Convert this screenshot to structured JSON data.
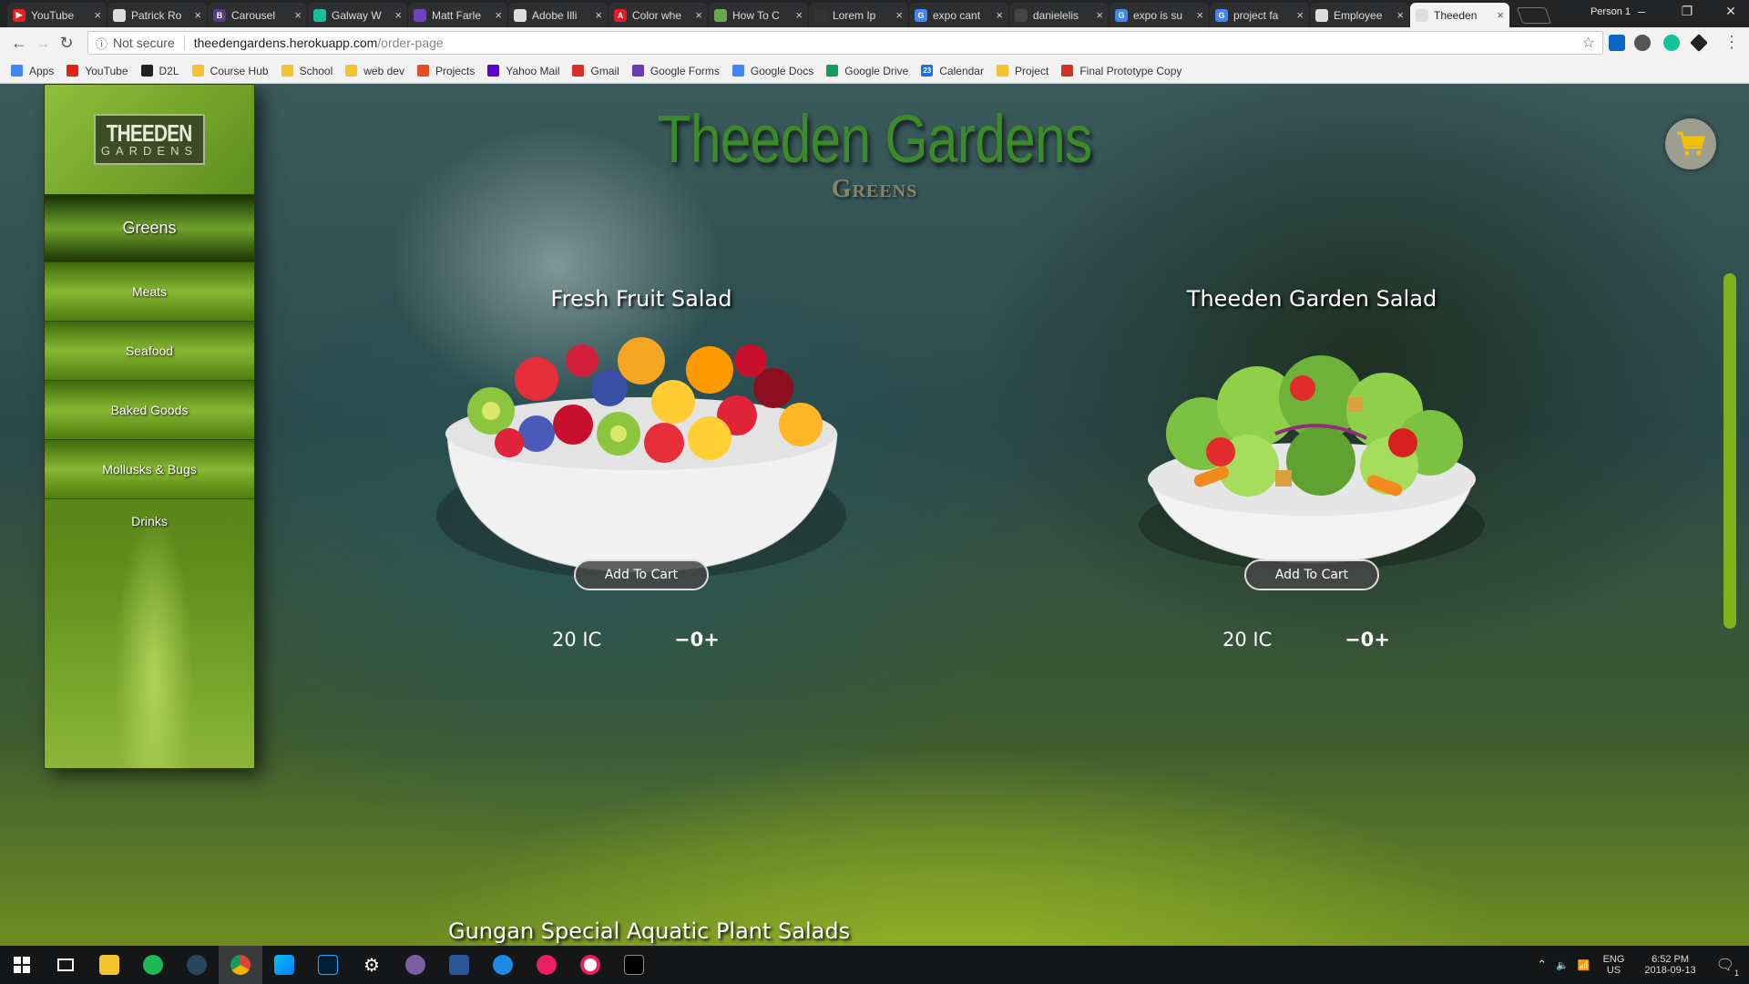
{
  "browser": {
    "tabs": [
      {
        "title": "YouTube",
        "favicon_color": "#e62117",
        "glyph": "▶"
      },
      {
        "title": "Patrick Ro",
        "favicon_color": "#dddddd",
        "glyph": ""
      },
      {
        "title": "Carousel",
        "favicon_color": "#563d7c",
        "glyph": "B"
      },
      {
        "title": "Galway W",
        "favicon_color": "#1abc9c",
        "glyph": ""
      },
      {
        "title": "Matt Farle",
        "favicon_color": "#6f42c1",
        "glyph": ""
      },
      {
        "title": "Adobe Illi",
        "favicon_color": "#dddddd",
        "glyph": ""
      },
      {
        "title": "Color whe",
        "favicon_color": "#e31b23",
        "glyph": "A"
      },
      {
        "title": "How To C",
        "favicon_color": "#6aa84f",
        "glyph": ""
      },
      {
        "title": "Lorem Ip",
        "favicon_color": "#333333",
        "glyph": ""
      },
      {
        "title": "expo cant",
        "favicon_color": "#4285f4",
        "glyph": "G"
      },
      {
        "title": "danielelis",
        "favicon_color": "#444444",
        "glyph": ""
      },
      {
        "title": "expo is su",
        "favicon_color": "#4285f4",
        "glyph": "G"
      },
      {
        "title": "project fa",
        "favicon_color": "#4285f4",
        "glyph": "G"
      },
      {
        "title": "Employee",
        "favicon_color": "#dddddd",
        "glyph": ""
      },
      {
        "title": "Theeden",
        "favicon_color": "#dddddd",
        "glyph": "",
        "active": true
      }
    ],
    "profile": "Person 1",
    "window_controls": {
      "minimize": "–",
      "restore": "❐",
      "close": "✕"
    },
    "omnibox": {
      "security": "Not secure",
      "host": "theedengardens.herokuapp.com",
      "path": "/order-page"
    },
    "bookmarks": [
      {
        "label": "Apps",
        "color": "#4285f4"
      },
      {
        "label": "YouTube",
        "color": "#e62117"
      },
      {
        "label": "D2L",
        "color": "#222222"
      },
      {
        "label": "Course Hub",
        "color": "#f4c430"
      },
      {
        "label": "School",
        "color": "#f4c430"
      },
      {
        "label": "web dev",
        "color": "#f4c430"
      },
      {
        "label": "Projects",
        "color": "#e44d26"
      },
      {
        "label": "Yahoo Mail",
        "color": "#5f01d1"
      },
      {
        "label": "Gmail",
        "color": "#d93025"
      },
      {
        "label": "Google Forms",
        "color": "#673ab7"
      },
      {
        "label": "Google Docs",
        "color": "#4285f4"
      },
      {
        "label": "Google Drive",
        "color": "#0f9d58"
      },
      {
        "label": "Calendar",
        "color": "#1a73e8",
        "glyph": "23"
      },
      {
        "label": "Project",
        "color": "#f4c430"
      },
      {
        "label": "Final Prototype Copy",
        "color": "#d93025"
      }
    ]
  },
  "site": {
    "logo": {
      "line1": "THEEDEN",
      "line2": "GARDENS"
    },
    "title": "Theeden Gardens",
    "subtitle": "Greens",
    "nav": [
      {
        "label": "Greens",
        "active": true
      },
      {
        "label": "Meats"
      },
      {
        "label": "Seafood"
      },
      {
        "label": "Baked Goods"
      },
      {
        "label": "Mollusks & Bugs"
      },
      {
        "label": "Drinks"
      }
    ],
    "products": [
      {
        "name": "Fresh Fruit Salad",
        "button": "Add To Cart",
        "price": "20 IC",
        "minus": "−",
        "qty": "0",
        "plus": "+"
      },
      {
        "name": "Theeden Garden Salad",
        "button": "Add To Cart",
        "price": "20 IC",
        "minus": "−",
        "qty": "0",
        "plus": "+"
      }
    ],
    "section_heading": "Gungan Special Aquatic Plant Salads"
  },
  "taskbar": {
    "lang": "ENG",
    "region": "US",
    "time": "6:52 PM",
    "date": "2018-09-13",
    "notification_count": "1"
  }
}
